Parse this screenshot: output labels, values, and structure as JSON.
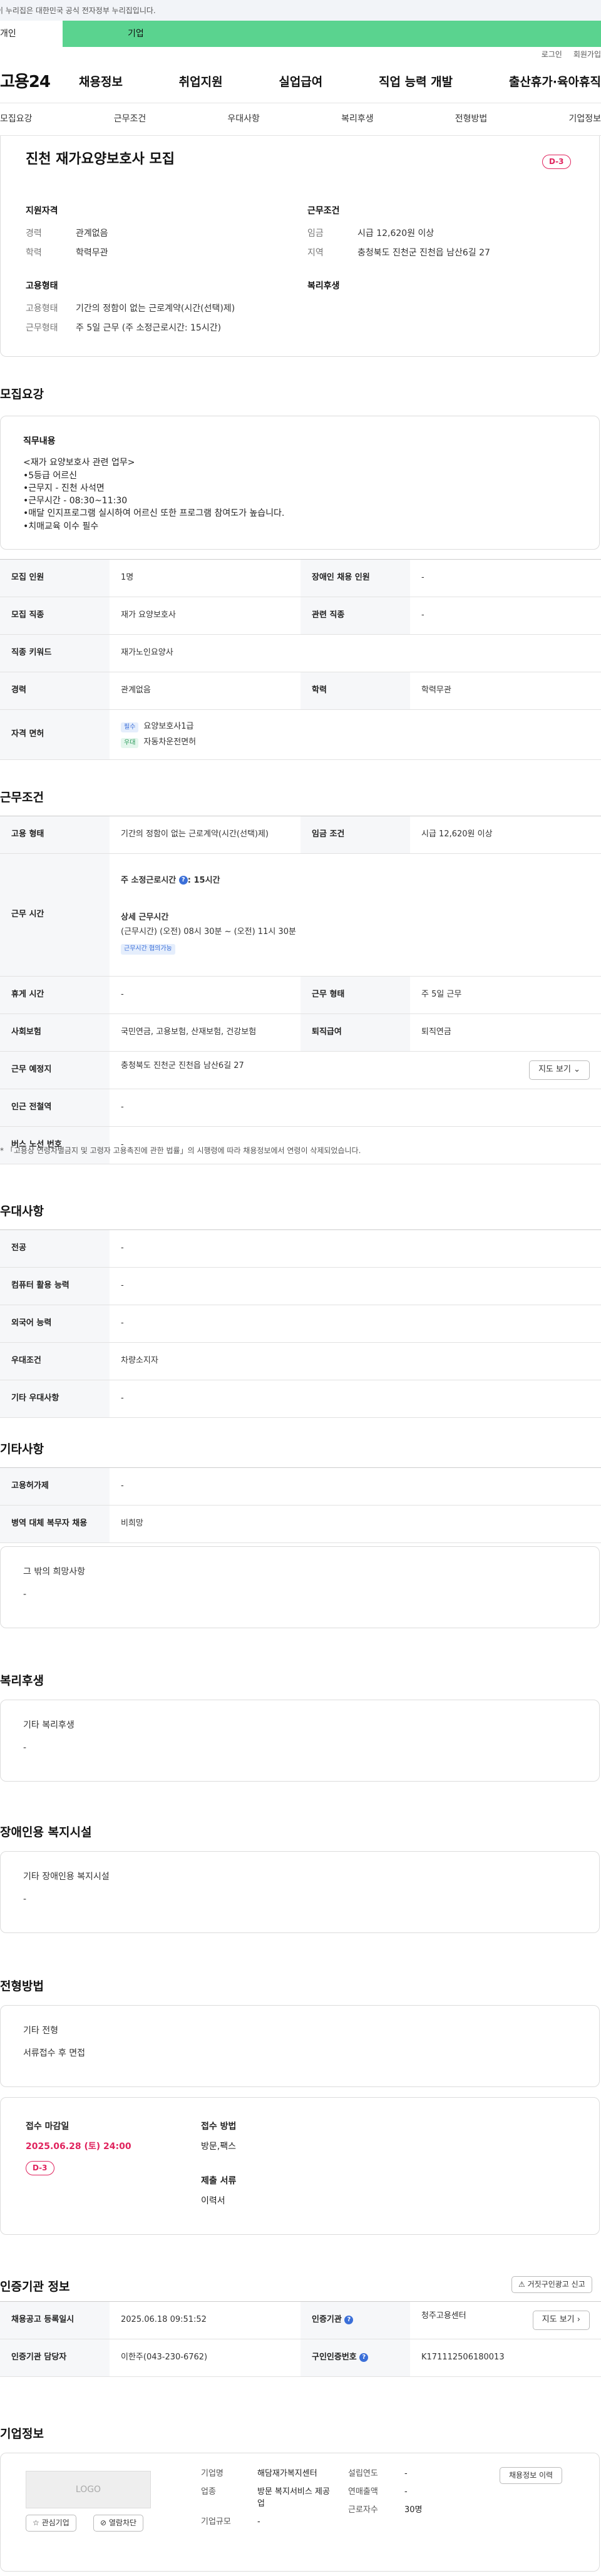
{
  "gov_notice": "이 누리집은 대한민국 공식 전자정부 누리집입니다.",
  "top_tabs": [
    "개인",
    "기업"
  ],
  "util_links": [
    "로그인",
    "회원가입"
  ],
  "site": {
    "logo": "고용24"
  },
  "gnb": [
    "채용정보",
    "취업지원",
    "실업급여",
    "직업 능력 개발",
    "출산휴가·육아휴직"
  ],
  "subnav": [
    "모집요강",
    "근무조건",
    "우대사항",
    "복리후생",
    "전형방법",
    "기업정보"
  ],
  "summary": {
    "title": "진천 재가요양보호사 모집",
    "dday": "D-3",
    "qual_title": "지원자격",
    "qual": [
      {
        "k": "경력",
        "v": "관계없음"
      },
      {
        "k": "학력",
        "v": "학력무관"
      }
    ],
    "cond_title": "근무조건",
    "cond": [
      {
        "k": "임금",
        "v": "시급 12,620원 이상"
      },
      {
        "k": "지역",
        "v": "충청북도 진천군 진천읍 남산6길 27"
      }
    ],
    "emp_title": "고용형태",
    "emp": [
      {
        "k": "고용형태",
        "v": "기간의 정함이 없는 근로계약(시간(선택)제)"
      },
      {
        "k": "근무형태",
        "v": "주 5일 근무 (주 소정근로시간: 15시간)"
      }
    ],
    "welfare_title": "복리후생"
  },
  "recruit": {
    "section_title": "모집요강",
    "duty_title": "직무내용",
    "duty_lines": [
      "<재가 요양보호사 관련 업무>",
      "•5등급 어르신",
      "•근무지 - 진천 사석면",
      "•근무시간 -  08:30~11:30",
      "•매달 인지프로그램 실시하여 어르신 또한 프로그램 참여도가 높습니다.",
      "•치매교육 이수  필수"
    ],
    "rows": [
      {
        "l": "모집 인원",
        "lv": "1명",
        "r": "장애인 채용 인원",
        "rv": "-"
      },
      {
        "l": "모집 직종",
        "lv": "재가 요양보호사",
        "r": "관련 직종",
        "rv": "-"
      },
      {
        "l": "직종 키워드",
        "lv": "재가노인요양사"
      },
      {
        "l": "경력",
        "lv": "관계없음",
        "r": "학력",
        "rv": "학력무관"
      }
    ],
    "license_label": "자격 면허",
    "licenses": [
      {
        "tag": "필수",
        "name": "요양보호사1급"
      },
      {
        "tag": "우대",
        "name": "자동차운전면허"
      }
    ]
  },
  "work": {
    "section_title": "근무조건",
    "emp_type_label": "고용 형태",
    "emp_type": "기간의 정함이 없는 근로계약(시간(선택)제)",
    "wage_label": "임금 조건",
    "wage": "시급 12,620원 이상",
    "hours_label": "근무 시간",
    "weekly_label": "주 소정근로시간",
    "weekly_value": ": 15시간",
    "detail_label": "상세 근무시간",
    "detail_value": "(근무시간) (오전) 08시 30분 ~ (오전) 11시 30분",
    "hours_tag": "근무시간 협의가능",
    "rest_label": "휴게 시간",
    "rest": "-",
    "form_label": "근무 형태",
    "form": "주 5일 근무",
    "insurance_label": "사회보험",
    "insurance": "국민연금, 고용보험, 산재보험, 건강보험",
    "severance_label": "퇴직급여",
    "severance": "퇴직연금",
    "place_label": "근무 예정지",
    "place": "충청북도 진천군 진천읍 남산6길 27",
    "map_btn": "지도 보기",
    "subway_label": "인근 전철역",
    "subway": "-",
    "bus_label": "버스 노선 번호",
    "bus": "-",
    "note": "* 「고용상 연령차별금지 및 고령자 고용촉진에 관한 법률」의 시행령에 따라 채용정보에서 연령이 삭제되었습니다."
  },
  "pref": {
    "section_title": "우대사항",
    "rows": [
      {
        "l": "전공",
        "v": "-"
      },
      {
        "l": "컴퓨터 활용 능력",
        "v": "-"
      },
      {
        "l": "외국어 능력",
        "v": "-"
      },
      {
        "l": "우대조건",
        "v": "차량소지자"
      },
      {
        "l": "기타 우대사항",
        "v": "-"
      }
    ]
  },
  "etc": {
    "section_title": "기타사항",
    "rows": [
      {
        "l": "고용허가제",
        "v": "-"
      },
      {
        "l": "병역 대체 복무자 채용",
        "v": "비희망"
      }
    ],
    "other_title": "그 밖의 희망사항",
    "other_value": "-"
  },
  "benefit": {
    "section_title": "복리후생",
    "box_title": "기타 복리후생",
    "box_value": "-"
  },
  "disab": {
    "section_title": "장애인용 복지시설",
    "box_title": "기타 장애인용 복지시설",
    "box_value": "-"
  },
  "select": {
    "section_title": "전형방법",
    "box_title": "기타 전형",
    "box_value": "서류접수 후 면접",
    "deadline_label": "접수 마감일",
    "deadline": "2025.06.28 (토) 24:00",
    "dday": "D-3",
    "method_label": "접수 방법",
    "method": "방문,팩스",
    "docs_label": "제출 서류",
    "docs": "이력서"
  },
  "cert": {
    "section_title": "인증기관 정보",
    "edit_btn": "거짓구인광고 신고",
    "reg_label": "채용공고 등록일시",
    "reg": "2025.06.18 09:51:52",
    "org_label": "인증기관",
    "org": "청주고용센터",
    "map_btn": "지도 보기",
    "mgr_label": "인증기관 담당자",
    "mgr": "이한주(043-230-6762)",
    "num_label": "구인인증번호",
    "num": "K171112506180013"
  },
  "company": {
    "section_title": "기업정보",
    "logo_text": "LOGO",
    "fav_btn": "관심기업",
    "block_btn": "열람차단",
    "name_label": "기업명",
    "name": "해담재가복지센터",
    "industry_label": "업종",
    "industry": "방문 복지서비스 제공업",
    "scale_label": "기업규모",
    "scale": "-",
    "founded_label": "설립연도",
    "founded": "-",
    "sales_label": "연매출액",
    "sales": "-",
    "staff_label": "근로자수",
    "staff": "30명",
    "history_btn": "채용정보 이력"
  }
}
